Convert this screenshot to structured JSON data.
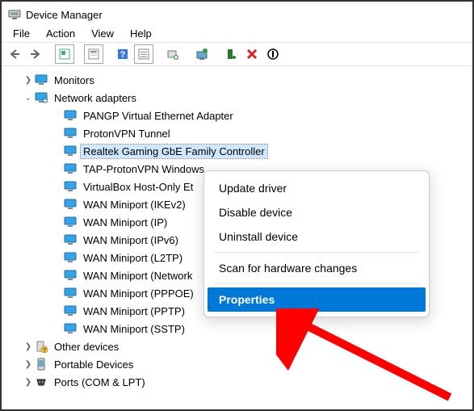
{
  "window": {
    "title": "Device Manager"
  },
  "menu": {
    "file": "File",
    "action": "Action",
    "view": "View",
    "help": "Help"
  },
  "tree": {
    "monitors": "Monitors",
    "network_adapters": "Network adapters",
    "adapters": {
      "pangp": "PANGP Virtual Ethernet Adapter",
      "protonvpn": "ProtonVPN Tunnel",
      "realtek": "Realtek Gaming GbE Family Controller",
      "tap": "TAP-ProtonVPN Windows",
      "vbox": "VirtualBox Host-Only Et",
      "wan_ikev2": "WAN Miniport (IKEv2)",
      "wan_ip": "WAN Miniport (IP)",
      "wan_ipv6": "WAN Miniport (IPv6)",
      "wan_l2tp": "WAN Miniport (L2TP)",
      "wan_network": "WAN Miniport (Network",
      "wan_pppoe": "WAN Miniport (PPPOE)",
      "wan_pptp": "WAN Miniport (PPTP)",
      "wan_sstp": "WAN Miniport (SSTP)"
    },
    "other_devices": "Other devices",
    "portable_devices": "Portable Devices",
    "ports": "Ports (COM & LPT)"
  },
  "context_menu": {
    "update": "Update driver",
    "disable": "Disable device",
    "uninstall": "Uninstall device",
    "scan": "Scan for hardware changes",
    "properties": "Properties"
  }
}
